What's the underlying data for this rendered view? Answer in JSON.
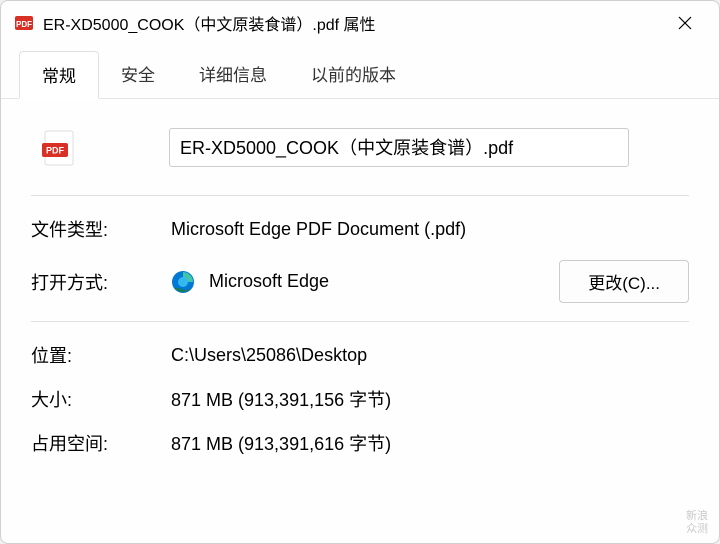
{
  "titlebar": {
    "title": "ER-XD5000_COOK（中文原装食谱）.pdf 属性"
  },
  "tabs": {
    "general": "常规",
    "security": "安全",
    "details": "详细信息",
    "previous": "以前的版本"
  },
  "file": {
    "name": "ER-XD5000_COOK（中文原装食谱）.pdf"
  },
  "labels": {
    "fileType": "文件类型:",
    "opensWith": "打开方式:",
    "location": "位置:",
    "size": "大小:",
    "sizeOnDisk": "占用空间:"
  },
  "values": {
    "fileType": "Microsoft Edge PDF Document (.pdf)",
    "appName": "Microsoft Edge",
    "location": "C:\\Users\\25086\\Desktop",
    "size": "871 MB (913,391,156 字节)",
    "sizeOnDisk": "871 MB (913,391,616 字节)"
  },
  "buttons": {
    "change": "更改(C)..."
  },
  "watermark": {
    "line1": "新浪",
    "line2": "众测"
  }
}
